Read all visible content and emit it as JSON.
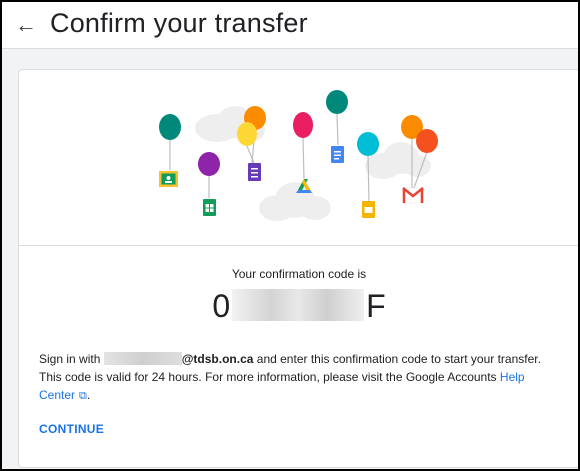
{
  "header": {
    "back_icon": "arrow-left-icon",
    "title": "Confirm your transfer"
  },
  "illustration": {
    "icons": [
      "classroom-icon",
      "sheets-icon",
      "forms-icon",
      "drive-icon",
      "docs-icon",
      "slides-icon",
      "gmail-icon",
      "cloud-icon",
      "balloon-icon"
    ]
  },
  "confirmation": {
    "label": "Your confirmation code is",
    "code_start": "0",
    "code_end": "F"
  },
  "info": {
    "sign_in_prefix": "Sign in with",
    "domain": "@tdsb.on.ca",
    "line1_rest": "and enter this confirmation code to start your transfer.",
    "line2": "This code is valid for 24 hours. For more information, please visit the Google Accounts",
    "help_link_1": "Help",
    "help_link_2": "Center",
    "period": "."
  },
  "actions": {
    "continue_label": "CONTINUE"
  },
  "colors": {
    "accent": "#1a73e8",
    "border": "#dadce0",
    "background": "#f1f3f4"
  }
}
